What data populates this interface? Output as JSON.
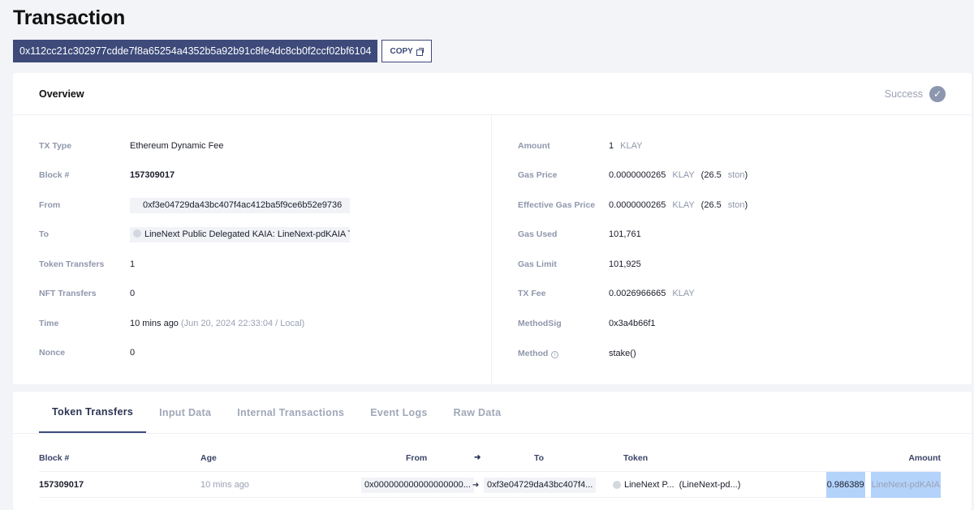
{
  "page": {
    "title": "Transaction",
    "tx_hash": "0x112cc21c302977cdde7f8a65254a4352b5a92b91c8fe4dc8cb0f2ccf02bf6104",
    "copy_label": "COPY"
  },
  "overview": {
    "title": "Overview",
    "status": "Success",
    "left": {
      "tx_type": {
        "label": "TX Type",
        "value": "Ethereum Dynamic Fee"
      },
      "block": {
        "label": "Block #",
        "value": "157309017"
      },
      "from": {
        "label": "From",
        "value": "0xf3e04729da43bc407f4ac412ba5f9ce6b52e9736"
      },
      "to": {
        "label": "To",
        "value": "LineNext Public Delegated KAIA: LineNext-pdKAIA T..."
      },
      "token_transfers": {
        "label": "Token Transfers",
        "value": "1"
      },
      "nft_transfers": {
        "label": "NFT Transfers",
        "value": "0"
      },
      "time": {
        "label": "Time",
        "value": "10 mins ago",
        "detail": "(Jun 20, 2024 22:33:04 / Local)"
      },
      "nonce": {
        "label": "Nonce",
        "value": "0"
      }
    },
    "right": {
      "amount": {
        "label": "Amount",
        "value": "1",
        "unit": "KLAY"
      },
      "gas_price": {
        "label": "Gas Price",
        "value": "0.0000000265",
        "unit": "KLAY",
        "ston_open": "(26.5",
        "ston_unit": "ston",
        "ston_close": ")"
      },
      "effective_gas_price": {
        "label": "Effective Gas Price",
        "value": "0.0000000265",
        "unit": "KLAY",
        "ston_open": "(26.5",
        "ston_unit": "ston",
        "ston_close": ")"
      },
      "gas_used": {
        "label": "Gas Used",
        "value": "101,761"
      },
      "gas_limit": {
        "label": "Gas Limit",
        "value": "101,925"
      },
      "tx_fee": {
        "label": "TX Fee",
        "value": "0.0026966665",
        "unit": "KLAY"
      },
      "method_sig": {
        "label": "MethodSig",
        "value": "0x3a4b66f1"
      },
      "method": {
        "label": "Method",
        "value": "stake()"
      }
    }
  },
  "tabs": [
    {
      "label": "Token Transfers",
      "active": true
    },
    {
      "label": "Input Data"
    },
    {
      "label": "Internal Transactions"
    },
    {
      "label": "Event Logs"
    },
    {
      "label": "Raw Data"
    }
  ],
  "transfers_table": {
    "headers": {
      "block": "Block #",
      "age": "Age",
      "from": "From",
      "arrow": "➜",
      "to": "To",
      "token": "Token",
      "amount": "Amount"
    },
    "rows": [
      {
        "block": "157309017",
        "age": "10 mins ago",
        "from": "0x000000000000000000...",
        "to": "0xf3e04729da43bc407f4...",
        "token_name": "LineNext P...",
        "token_symbol": "(LineNext-pd...)",
        "amount": "0.986389",
        "amount_unit": "LineNext-pdKAIA"
      }
    ]
  }
}
